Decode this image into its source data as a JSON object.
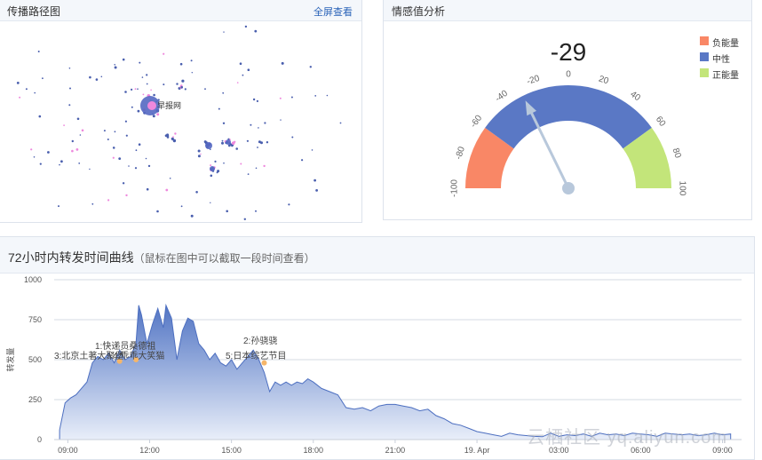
{
  "propagation": {
    "title": "传播路径图",
    "fullscreen_label": "全屏查看",
    "center_node_label": "早报网"
  },
  "sentiment": {
    "title": "情感值分析",
    "value": "-29",
    "value_number": -29,
    "scale_min": -100,
    "scale_max": 100,
    "ticks": [
      "-100",
      "-80",
      "-60",
      "-40",
      "-20",
      "0",
      "20",
      "40",
      "60",
      "80",
      "100"
    ],
    "legend": [
      {
        "label": "负能量",
        "color": "#f98766"
      },
      {
        "label": "中性",
        "color": "#5a78c5"
      },
      {
        "label": "正能量",
        "color": "#c3e57a"
      }
    ]
  },
  "timeline": {
    "title": "72小时内转发时间曲线",
    "subtitle": "（鼠标在图中可以截取一段时间查看）",
    "watermark": "云栖社区 yq.aliyun.com",
    "annotations": [
      "1:快递员桑德祖",
      "2:孙骁骁",
      "3:北京土著大聚堡",
      "4:乖乖大笑猫",
      "5:日本综艺节目"
    ]
  },
  "chart_data": {
    "type": "area",
    "title": "",
    "xlabel": "",
    "ylabel": "转发量",
    "ylim": [
      0,
      1000
    ],
    "yticks": [
      "0",
      "250",
      "500",
      "750",
      "1000"
    ],
    "xticks": [
      "09:00",
      "12:00",
      "15:00",
      "18:00",
      "21:00",
      "19. Apr",
      "03:00",
      "06:00",
      "09:00"
    ],
    "x_hours": [
      8.7,
      8.9,
      9.1,
      9.3,
      9.5,
      9.7,
      9.9,
      10.1,
      10.3,
      10.5,
      10.7,
      10.9,
      11.1,
      11.3,
      11.5,
      11.6,
      11.7,
      11.9,
      12.1,
      12.3,
      12.5,
      12.6,
      12.8,
      13.0,
      13.2,
      13.4,
      13.6,
      13.8,
      14.0,
      14.2,
      14.4,
      14.6,
      14.8,
      15.0,
      15.2,
      15.4,
      15.6,
      15.8,
      16.0,
      16.2,
      16.4,
      16.6,
      16.8,
      17.0,
      17.2,
      17.4,
      17.6,
      17.8,
      18.0,
      18.3,
      18.6,
      18.9,
      19.2,
      19.5,
      19.8,
      20.1,
      20.4,
      20.7,
      21.0,
      21.3,
      21.6,
      21.9,
      22.2,
      22.5,
      22.8,
      23.1,
      23.4,
      23.7,
      24.0,
      24.3,
      24.6,
      24.9,
      25.2,
      25.5,
      25.8,
      26.1,
      26.4,
      26.7,
      27.0,
      27.3,
      27.6,
      27.9,
      28.2,
      28.5,
      28.8,
      29.1,
      29.4,
      29.7,
      30.0,
      30.3,
      30.6,
      30.9,
      31.2,
      31.5,
      31.8,
      32.1,
      32.4,
      32.7,
      33.0,
      33.3
    ],
    "values": [
      60,
      230,
      260,
      280,
      320,
      360,
      480,
      520,
      500,
      540,
      480,
      560,
      500,
      520,
      600,
      840,
      780,
      600,
      720,
      820,
      700,
      840,
      760,
      500,
      680,
      760,
      740,
      600,
      560,
      500,
      540,
      480,
      460,
      500,
      440,
      480,
      520,
      560,
      500,
      420,
      300,
      360,
      340,
      360,
      340,
      360,
      350,
      380,
      360,
      320,
      300,
      280,
      200,
      190,
      200,
      180,
      210,
      220,
      220,
      210,
      200,
      180,
      190,
      150,
      130,
      100,
      90,
      70,
      50,
      40,
      30,
      20,
      40,
      30,
      25,
      20,
      18,
      40,
      20,
      30,
      25,
      35,
      20,
      40,
      30,
      35,
      25,
      40,
      35,
      30,
      20,
      40,
      35,
      30,
      35,
      25,
      30,
      40,
      30,
      35
    ],
    "series": [
      {
        "name": "转发量"
      }
    ]
  }
}
